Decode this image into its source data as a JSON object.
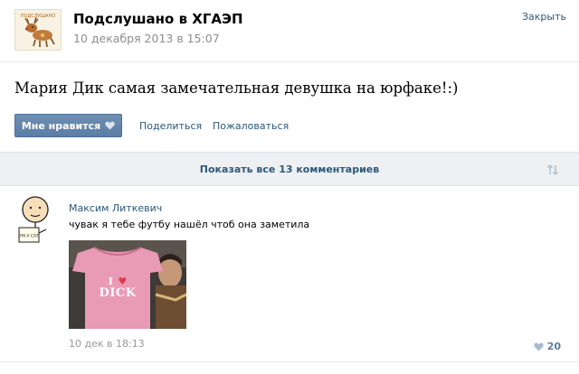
{
  "post": {
    "group_name": "Подслушано в ХГАЭП",
    "date": "10 декабря 2013 в 15:07",
    "close_label": "Закрыть",
    "avatar_logo_text": "ПОДСЛУШАНО",
    "text": "Мария Дик самая замечательная девушка на юрфаке!:)"
  },
  "actions": {
    "like_label": "Мне нравится",
    "share_label": "Поделиться",
    "report_label": "Пожаловаться"
  },
  "comments_bar": {
    "show_all_label": "Показать все 13 комментариев",
    "sort_icon": "sort-arrows-icon"
  },
  "comment": {
    "author": "Максим Литкевич",
    "text": "чувак я тебе футбу нашёл чтоб она заметила",
    "photo_text_line1": "I",
    "photo_heart": "♥",
    "photo_text_line2": "DICK",
    "avatar_sign_text": "I'M A CAT",
    "date": "10 дек в 18:13",
    "likes": "20"
  },
  "colors": {
    "link": "#2b587a",
    "like_button": "#5b7ea6",
    "bar_bg": "#eef0f3",
    "muted": "#8d8d8d"
  }
}
